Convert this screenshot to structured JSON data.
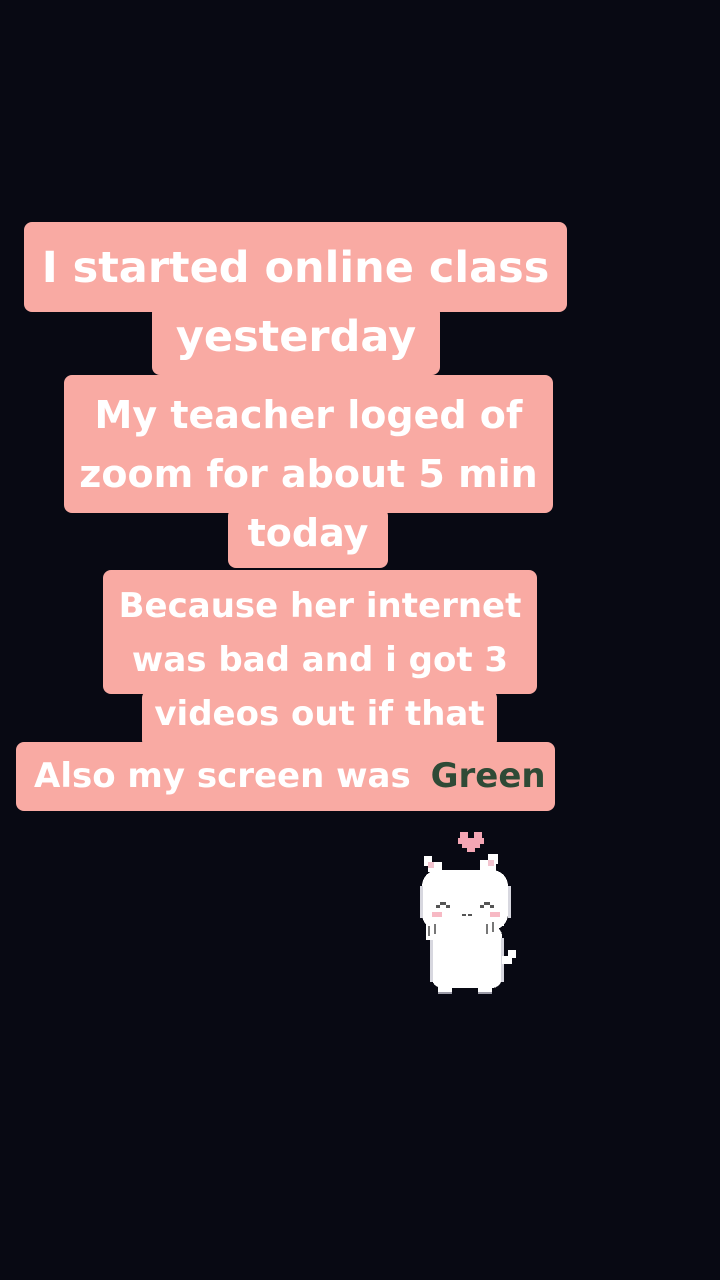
{
  "captions": [
    {
      "lines": [
        "I started online class",
        "yesterday"
      ]
    },
    {
      "lines": [
        "My teacher loged of",
        "zoom for about 5 min",
        "today"
      ]
    },
    {
      "lines": [
        "Because her internet",
        "was bad and i got 3",
        "videos out if that"
      ]
    },
    {
      "prefix": "Also my screen was",
      "highlight": "Green"
    }
  ],
  "sticker": {
    "icon": "pixel-cat-heart-icon"
  },
  "colors": {
    "background": "#080913",
    "caption_bg": "#f9aaa3",
    "caption_text": "#ffffff",
    "highlight_text": "#2f4a36"
  }
}
